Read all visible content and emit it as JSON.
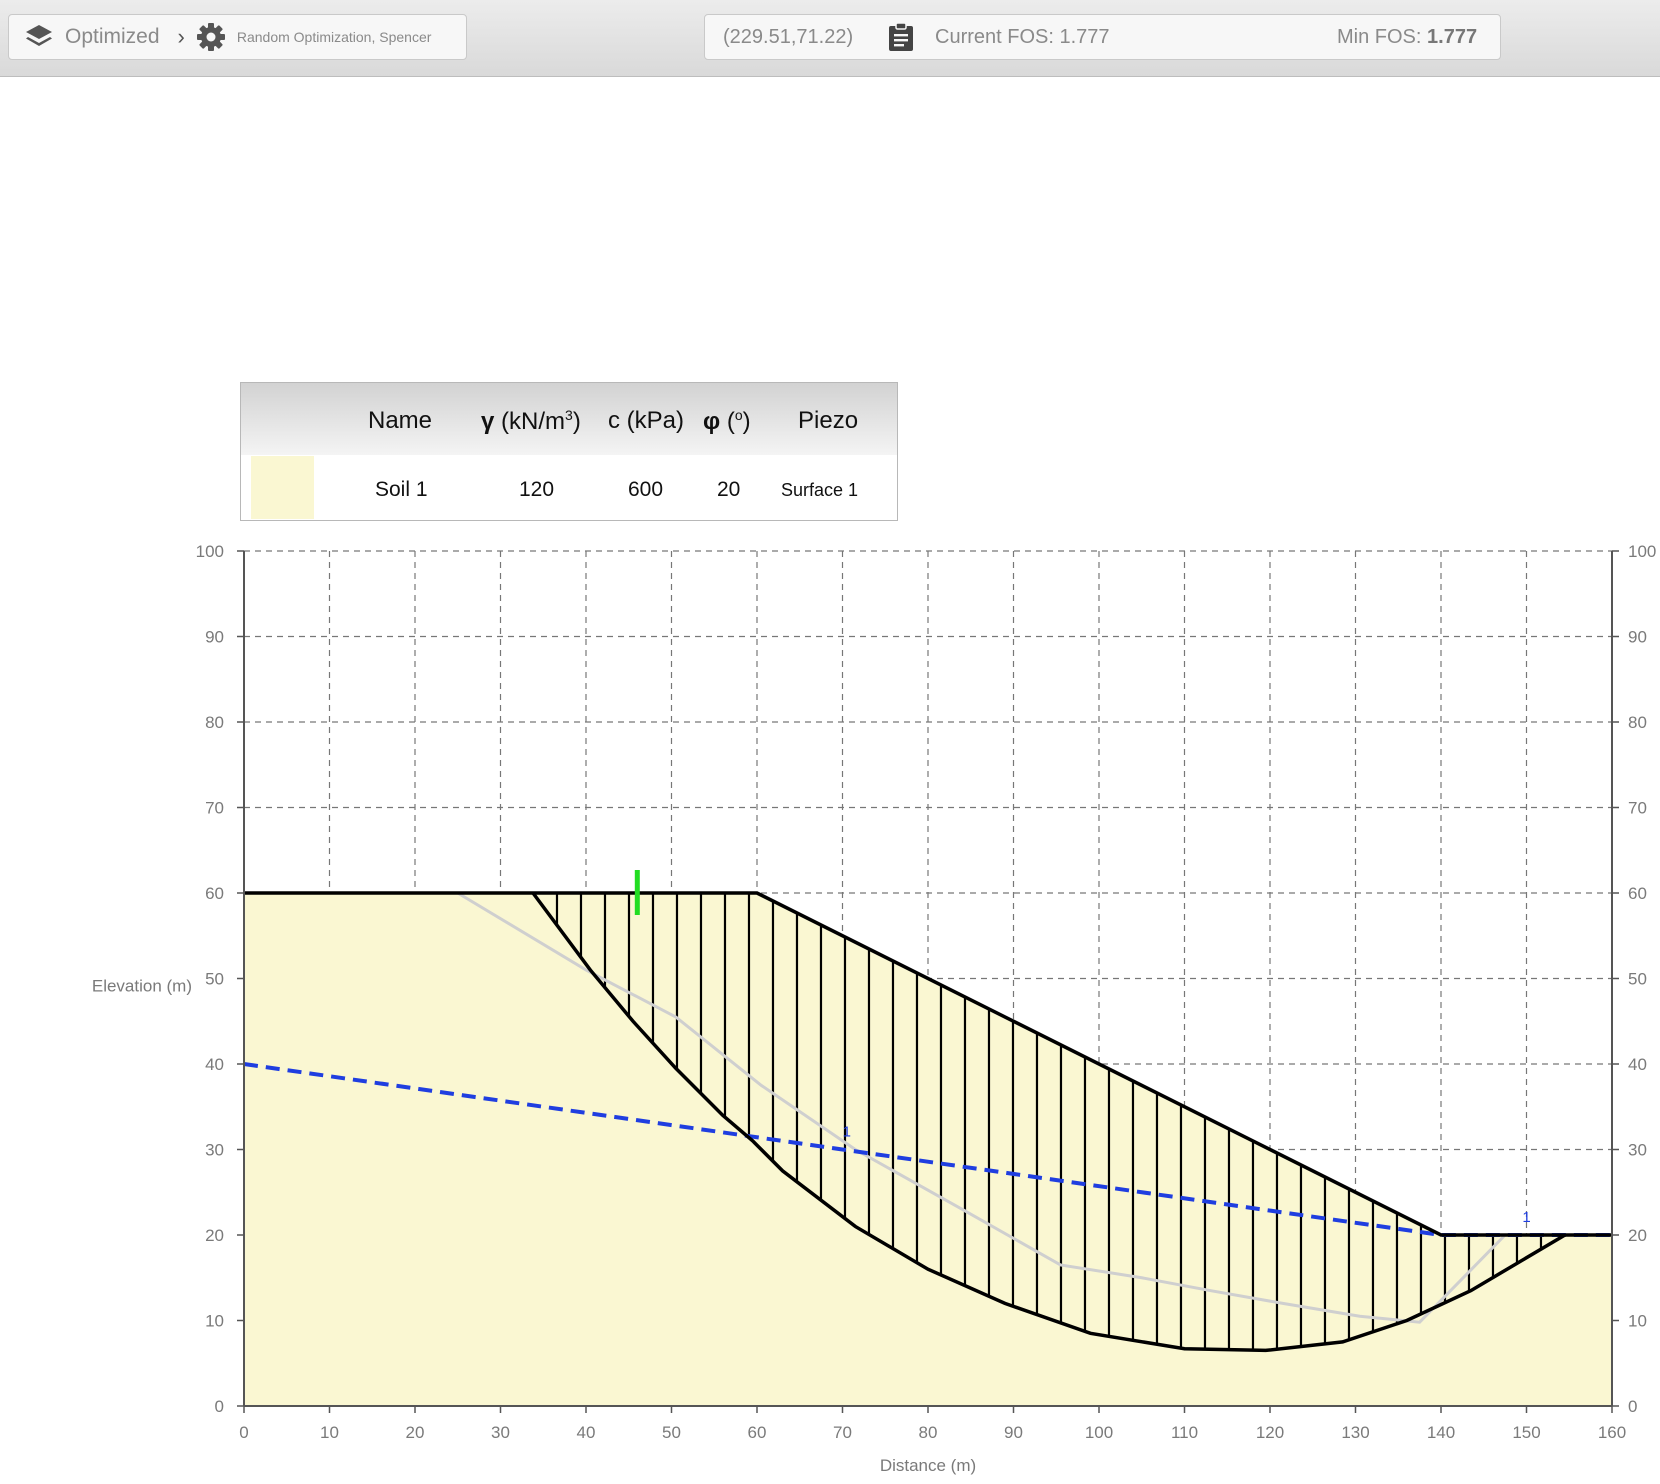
{
  "toolbar": {
    "breadcrumb_main": "Optimized",
    "breadcrumb_sub": "Random Optimization, Spencer",
    "coords": "(229.51,71.22)",
    "current_fos": "Current FOS: 1.777",
    "min_fos_label": "Min FOS:",
    "min_fos_value": "1.777",
    "icons": [
      "layers-icon",
      "chevron-right-icon",
      "gear-icon",
      "clipboard-icon"
    ]
  },
  "legend": {
    "headers": {
      "name": "Name",
      "gamma_sym": "γ",
      "gamma_unit_a": " (kN/m",
      "gamma_exp": "3",
      "gamma_unit_b": ")",
      "c": "c (kPa)",
      "phi_sym": "φ",
      "phi_unit_a": " (",
      "phi_exp": "o",
      "phi_unit_b": ")",
      "piezo": "Piezo"
    },
    "rows": [
      {
        "name": "Soil 1",
        "gamma": "120",
        "c": "600",
        "phi": "20",
        "piezo": "Surface 1",
        "color": "#faf7d2"
      }
    ]
  },
  "chart_data": {
    "type": "line",
    "xlabel": "Distance (m)",
    "ylabel": "Elevation (m)",
    "xlim": [
      0,
      160
    ],
    "ylim": [
      0,
      100
    ],
    "xticks": [
      0,
      10,
      20,
      30,
      40,
      50,
      60,
      70,
      80,
      90,
      100,
      110,
      120,
      130,
      140,
      150,
      160
    ],
    "yticks": [
      0,
      10,
      20,
      30,
      40,
      50,
      60,
      70,
      80,
      90,
      100
    ],
    "grid": true,
    "colors": {
      "soil": "#faf7d2",
      "piezo": "#1f3ee0",
      "trial": "#cfcfcf",
      "marker": "#22dd22",
      "outline": "#000000"
    },
    "ground_surface": [
      [
        0,
        60
      ],
      [
        60,
        60
      ],
      [
        140,
        20
      ],
      [
        160,
        20
      ]
    ],
    "slip_surface": [
      [
        33.8,
        60
      ],
      [
        40.5,
        51
      ],
      [
        45.5,
        45
      ],
      [
        50.5,
        39.5
      ],
      [
        56,
        34
      ],
      [
        59.5,
        31
      ],
      [
        63,
        27.5
      ],
      [
        71.5,
        21
      ],
      [
        80,
        16
      ],
      [
        89,
        12
      ],
      [
        99,
        8.5
      ],
      [
        110,
        6.7
      ],
      [
        119.5,
        6.5
      ],
      [
        128.5,
        7.5
      ],
      [
        136,
        10
      ],
      [
        143.5,
        13.5
      ],
      [
        154.5,
        20
      ]
    ],
    "piezometric_line": {
      "name": "1",
      "points": [
        [
          0,
          40
        ],
        [
          140,
          20
        ],
        [
          160,
          20
        ]
      ]
    },
    "trial_surface": [
      [
        25,
        60
      ],
      [
        40,
        51
      ],
      [
        50.5,
        45.5
      ],
      [
        60.5,
        37.5
      ],
      [
        71.5,
        30
      ],
      [
        84,
        23
      ],
      [
        95.5,
        16.5
      ],
      [
        105,
        15
      ],
      [
        113,
        13.5
      ],
      [
        121.5,
        12
      ],
      [
        130.5,
        10.5
      ],
      [
        137.5,
        9.8
      ],
      [
        147.5,
        20
      ]
    ],
    "slice_count": 43,
    "marker_x": 46,
    "piezo_labels": [
      {
        "text": "1",
        "x": 70.5,
        "y": 31.5
      },
      {
        "text": "1",
        "x": 150,
        "y": 21.5
      }
    ]
  }
}
